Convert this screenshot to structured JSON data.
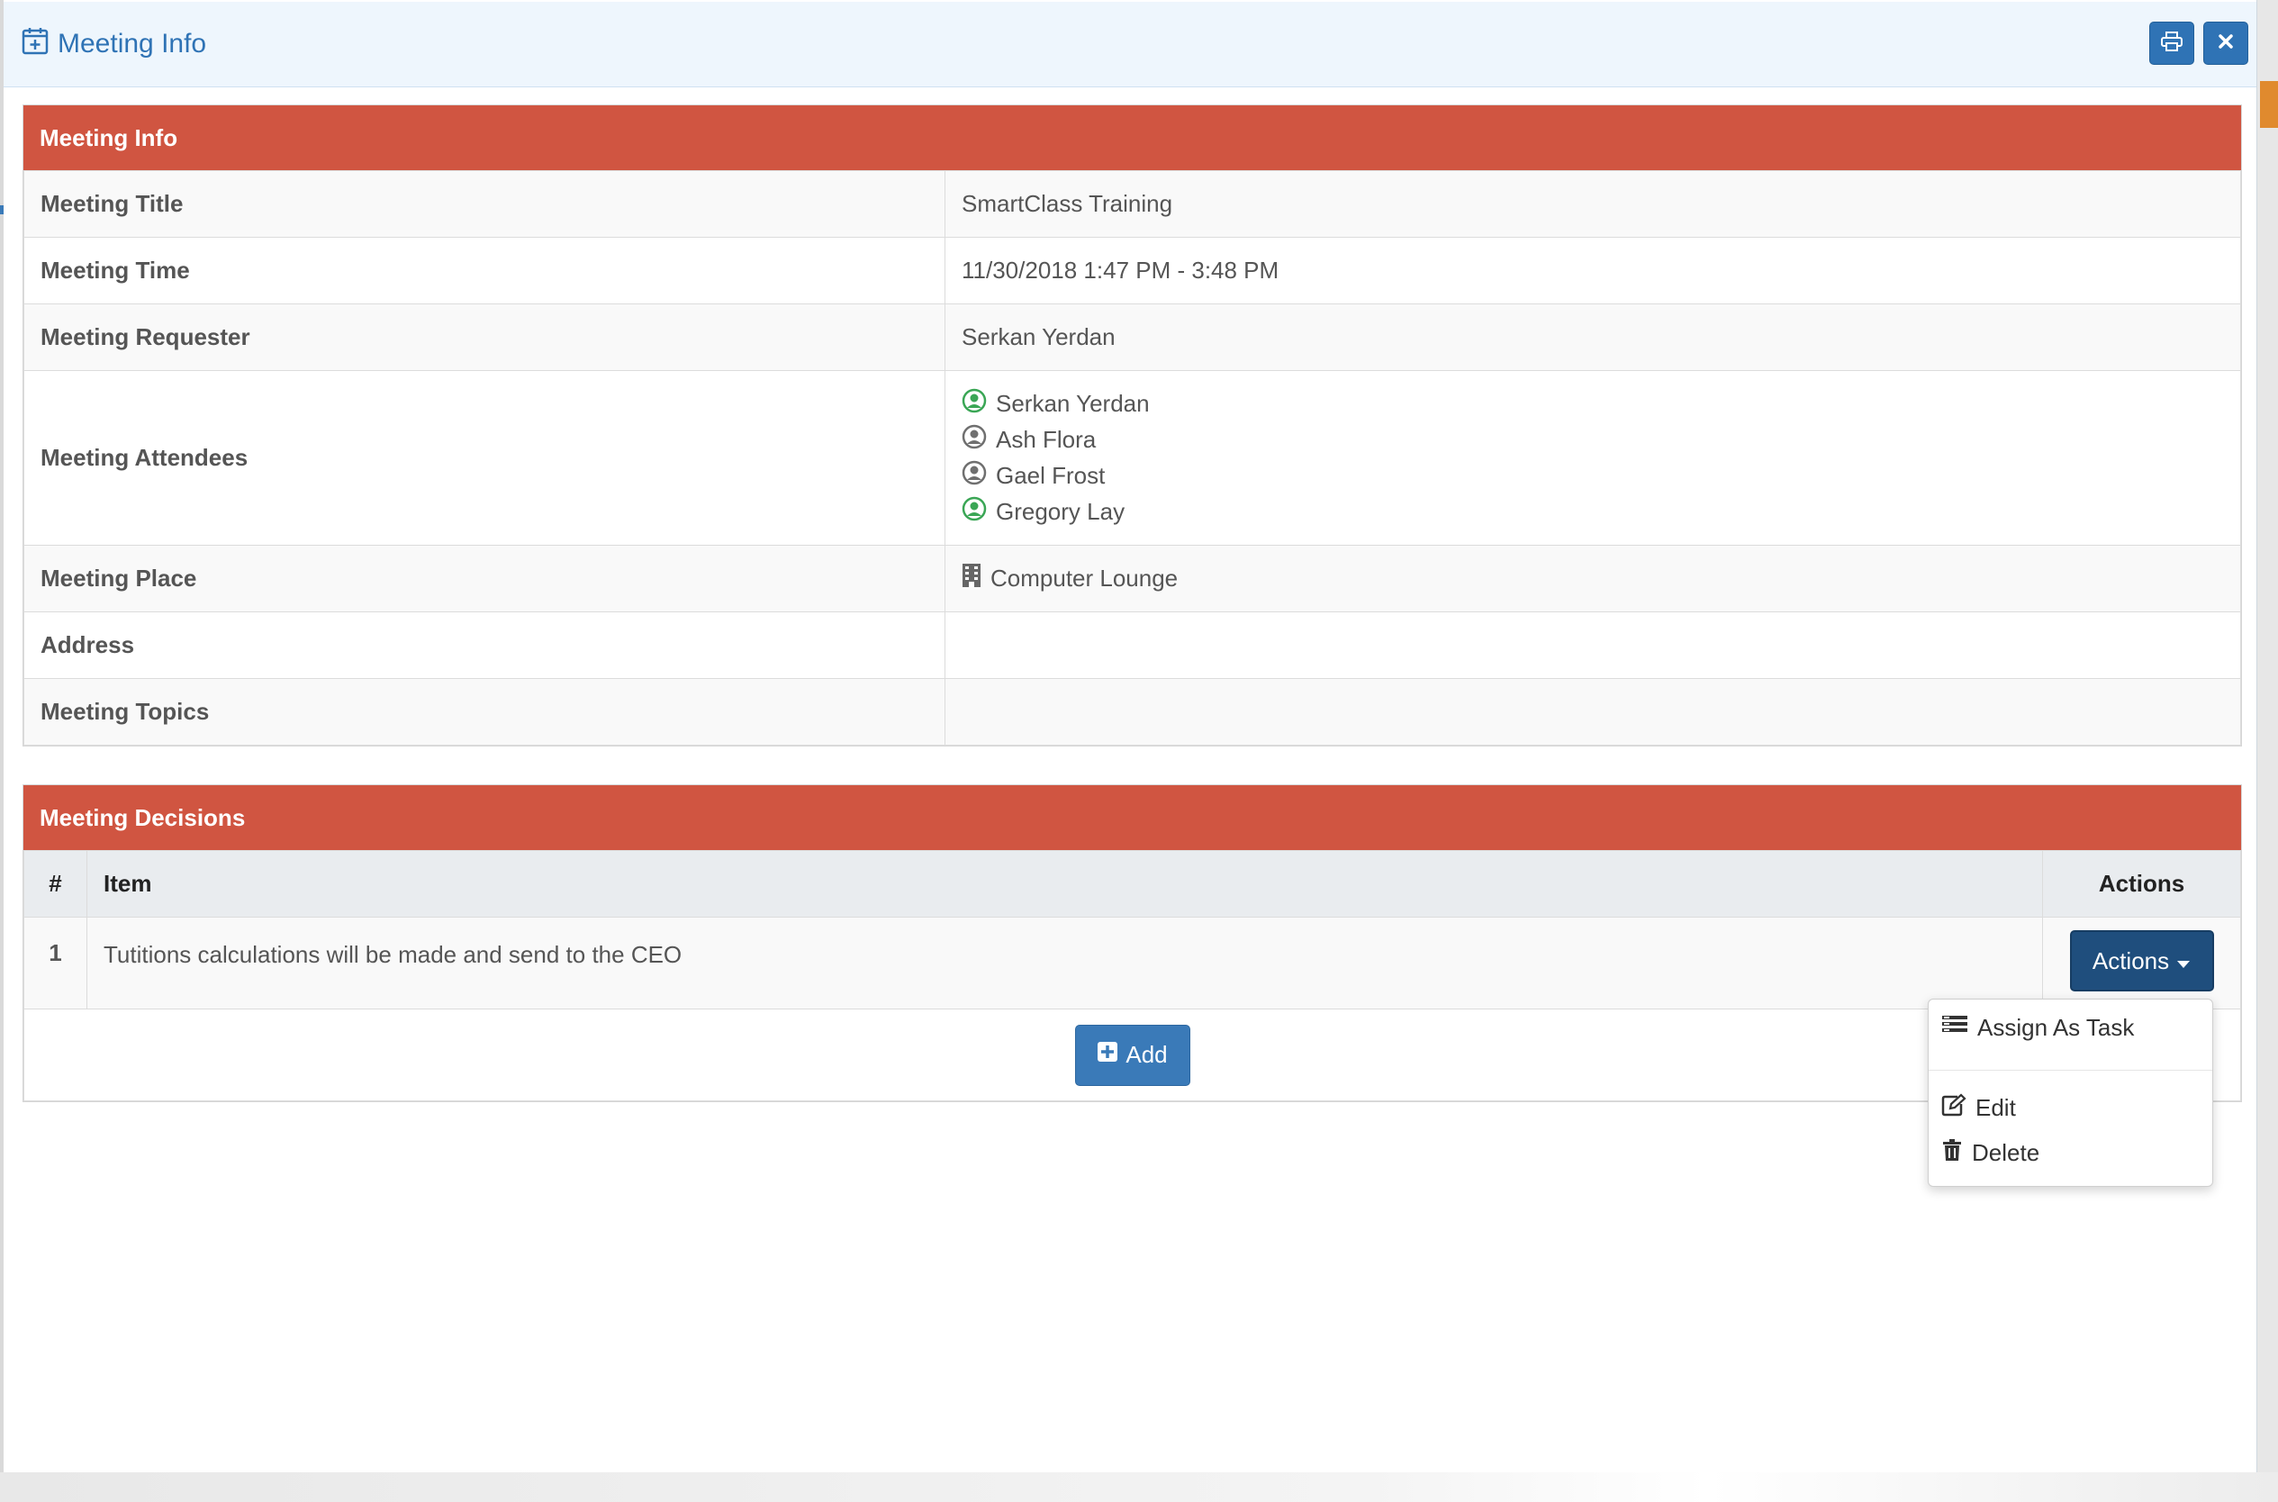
{
  "modal": {
    "title": "Meeting Info",
    "icons": {
      "title": "calendar-plus-icon",
      "print": "printer-icon",
      "close": "close-icon"
    }
  },
  "info_panel": {
    "heading": "Meeting Info",
    "rows": {
      "title": {
        "label": "Meeting Title",
        "value": "SmartClass Training"
      },
      "time": {
        "label": "Meeting Time",
        "value": "11/30/2018 1:47 PM - 3:48 PM"
      },
      "requester": {
        "label": "Meeting Requester",
        "value": "Serkan Yerdan"
      },
      "attendees": {
        "label": "Meeting Attendees",
        "list": [
          {
            "name": "Serkan Yerdan",
            "status_color": "#3aa655"
          },
          {
            "name": "Ash Flora",
            "status_color": "#6f6f6f"
          },
          {
            "name": "Gael Frost",
            "status_color": "#6f6f6f"
          },
          {
            "name": "Gregory Lay",
            "status_color": "#3aa655"
          }
        ]
      },
      "place": {
        "label": "Meeting Place",
        "value": "Computer Lounge",
        "icon": "building-icon"
      },
      "address": {
        "label": "Address",
        "value": ""
      },
      "topics": {
        "label": "Meeting Topics",
        "value": ""
      }
    }
  },
  "decisions_panel": {
    "heading": "Meeting Decisions",
    "columns": {
      "num": "#",
      "item": "Item",
      "actions": "Actions"
    },
    "rows": [
      {
        "num": "1",
        "item": "Tutitions calculations will be made and send to the CEO",
        "actions_label": "Actions"
      }
    ],
    "add_label": "Add"
  },
  "dropdown": {
    "assign": "Assign As Task",
    "edit": "Edit",
    "delete": "Delete"
  },
  "colors": {
    "panel_heading": "#d05541",
    "primary": "#2f73b5",
    "actions_button": "#1f4e7d",
    "header_bg": "#eef6fd"
  }
}
